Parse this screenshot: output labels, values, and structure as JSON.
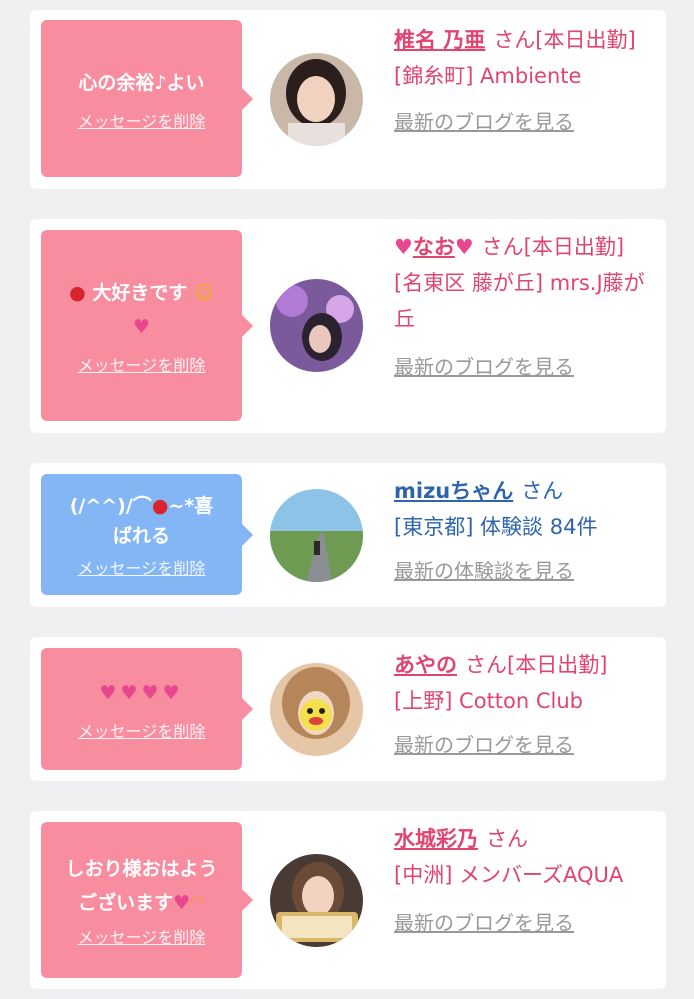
{
  "delete_label": "メッセージを削除",
  "colors": {
    "pink_bubble": "#f88da0",
    "blue_bubble": "#84b6f6",
    "pink_text": "#e0446f",
    "blue_text": "#2e64ad"
  },
  "items": [
    {
      "message": "心の余裕♪よい",
      "name": "椎名 乃亜",
      "honorific": "さん[本日出勤]",
      "location": "[錦糸町] Ambiente",
      "link": "最新のブログを見る"
    },
    {
      "message_line1": "大好きです",
      "message_icons": [
        "strawberry-icon",
        "smiling-face-icon",
        "heart-icon"
      ],
      "name": "なお",
      "name_icons": [
        "heart-ribbon-icon",
        "heart-ribbon-icon"
      ],
      "honorific": "さん[本日出勤]",
      "location": "[名東区 藤が丘] mrs.J藤が丘",
      "link": "最新のブログを見る"
    },
    {
      "message_line1_a": "(/^^)/⌒",
      "message_line1_b": "~*喜",
      "message_line2": "ばれる",
      "message_icons": [
        "strawberry-icon"
      ],
      "name": "mizuちゃん",
      "honorific": "さん",
      "location": "[東京都] 体験談 84件",
      "link": "最新の体験談を見る"
    },
    {
      "message_icons": [
        "heart-icon",
        "heart-icon",
        "heart-icon",
        "heart-icon"
      ],
      "name": "あやの",
      "honorific": "さん[本日出勤]",
      "location": "[上野] Cotton Club",
      "link": "最新のブログを見る"
    },
    {
      "message_line1": "しおり様おはよう",
      "message_line2": "ございます",
      "message_icons": [
        "heart-ribbon-icon",
        "rainbow-icon"
      ],
      "name": "水城彩乃",
      "honorific": "さん",
      "location": "[中洲] メンバーズAQUA",
      "link": "最新のブログを見る"
    }
  ]
}
